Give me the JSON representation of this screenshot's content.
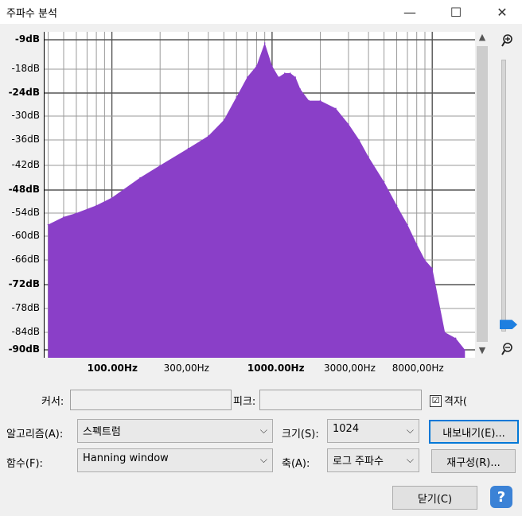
{
  "window": {
    "title": "주파수 분석",
    "minimize": "—",
    "maximize": "☐",
    "close": "✕"
  },
  "plot": {
    "color": "#8a3fc8",
    "y_labels": [
      "-9dB",
      "-18dB",
      "-24dB",
      "-30dB",
      "-36dB",
      "-42dB",
      "-48dB",
      "-54dB",
      "-60dB",
      "-66dB",
      "-72dB",
      "-78dB",
      "-84dB",
      "-90dB"
    ],
    "y_bold": [
      true,
      false,
      true,
      false,
      false,
      false,
      true,
      false,
      false,
      false,
      true,
      false,
      false,
      true
    ],
    "x_labels": [
      "100.00Hz",
      "300,00Hz",
      "1000.00Hz",
      "3000,00Hz",
      "8000,00Hz"
    ],
    "x_bold": [
      true,
      false,
      true,
      false,
      false
    ]
  },
  "chart_data": {
    "type": "area",
    "xlabel": "",
    "ylabel": "",
    "x_scale": "log",
    "ylim": [
      -92,
      -9
    ],
    "x": [
      40,
      50,
      60,
      80,
      100,
      150,
      200,
      300,
      400,
      500,
      600,
      700,
      800,
      900,
      1000,
      1100,
      1200,
      1300,
      1400,
      1500,
      1700,
      2000,
      2500,
      3000,
      3500,
      4000,
      5000,
      6000,
      7000,
      8000,
      9000,
      10000,
      12000,
      14000,
      16000
    ],
    "values": [
      -57,
      -55,
      -54,
      -52,
      -50,
      -45,
      -42,
      -38,
      -35,
      -31,
      -25,
      -20,
      -17,
      -10,
      -17,
      -20,
      -19,
      -19,
      -20,
      -23,
      -26,
      -26,
      -28,
      -32,
      -36,
      -40,
      -46,
      -52,
      -57,
      -62,
      -66,
      -68,
      -84,
      -86,
      -90
    ]
  },
  "zoom": {
    "in_icon": "zoom-in-icon",
    "out_icon": "zoom-out-icon",
    "level": 0.98
  },
  "cursor": {
    "label": "커서:",
    "value": ""
  },
  "peak": {
    "label": "피크:",
    "value": ""
  },
  "grid": {
    "label": "격자(",
    "checked": "☑"
  },
  "algorithm": {
    "label": "알고리즘(A):",
    "value": "스펙트럼"
  },
  "size": {
    "label": "크기(S):",
    "value": "1024"
  },
  "export_button": "내보내기(E)...",
  "function": {
    "label": "함수(F):",
    "value": "Hanning window"
  },
  "axis": {
    "label": "축(A):",
    "value": "로그 주파수"
  },
  "replot_button": "재구성(R)...",
  "close_button": "닫기(C)",
  "help_button": "?"
}
